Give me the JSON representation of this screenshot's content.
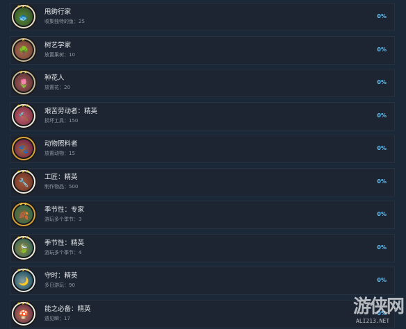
{
  "achievements": [
    {
      "name": "甩鉤行家",
      "desc": "收集独特的鱼：25",
      "percent": "0%",
      "icon": "fishing-badge-icon",
      "ring": "#e7e0c8",
      "c1": "#3a5a2a",
      "c2": "#5a8a3a",
      "glyph": "🐟",
      "stars": "★★★"
    },
    {
      "name": "树艺学家",
      "desc": "放置果树：10",
      "percent": "0%",
      "icon": "fruit-tree-badge-icon",
      "ring": "#c8b89a",
      "c1": "#7a4a3a",
      "c2": "#b06a50",
      "glyph": "🌳",
      "stars": "★"
    },
    {
      "name": "种花人",
      "desc": "放置花：20",
      "percent": "0%",
      "icon": "flower-badge-icon",
      "ring": "#c8b89a",
      "c1": "#6a3a3a",
      "c2": "#a05a5a",
      "glyph": "🌷",
      "stars": "★★"
    },
    {
      "name": "艰苦劳动者：精英",
      "desc": "损坏工具：150",
      "percent": "0%",
      "icon": "tools-badge-icon",
      "ring": "#f0ece4",
      "c1": "#8a3a4a",
      "c2": "#c06070",
      "glyph": "🔨",
      "stars": "★★★"
    },
    {
      "name": "动物照料者",
      "desc": "放置动物：15",
      "percent": "0%",
      "icon": "animal-care-badge-icon",
      "ring": "#d9a23a",
      "c1": "#7a2a4a",
      "c2": "#a06a3a",
      "glyph": "🐾",
      "stars": ""
    },
    {
      "name": "工匠：精英",
      "desc": "制作物品：500",
      "percent": "0%",
      "icon": "crafting-badge-icon",
      "ring": "#f0ece4",
      "c1": "#7a3a2a",
      "c2": "#a05a3a",
      "glyph": "🔧",
      "stars": "★★★"
    },
    {
      "name": "季节性：专家",
      "desc": "游玩多个季节：3",
      "percent": "0%",
      "icon": "seasons-badge-icon",
      "ring": "#d9a23a",
      "c1": "#3a6a4a",
      "c2": "#7a6a3a",
      "glyph": "🍂",
      "stars": "★★"
    },
    {
      "name": "季节性：精英",
      "desc": "游玩多个季节：4",
      "percent": "0%",
      "icon": "seasons-elite-badge-icon",
      "ring": "#f0ece4",
      "c1": "#3a6a5a",
      "c2": "#a08a3a",
      "glyph": "🍃",
      "stars": "★★★"
    },
    {
      "name": "守时：精英",
      "desc": "多日游玩：90",
      "percent": "0%",
      "icon": "clock-badge-icon",
      "ring": "#e0e8ec",
      "c1": "#2a5a6a",
      "c2": "#8aa0a0",
      "glyph": "🌙",
      "stars": "★★★"
    },
    {
      "name": "能之必备：精英",
      "desc": "遗见瞬：17",
      "percent": "0%",
      "icon": "essentials-badge-icon",
      "ring": "#f0ece4",
      "c1": "#7a3a4a",
      "c2": "#b07a5a",
      "glyph": "🍄",
      "stars": "★★★"
    }
  ],
  "watermark": {
    "mark": "游侠网",
    "sub": "ALI213.NET"
  }
}
